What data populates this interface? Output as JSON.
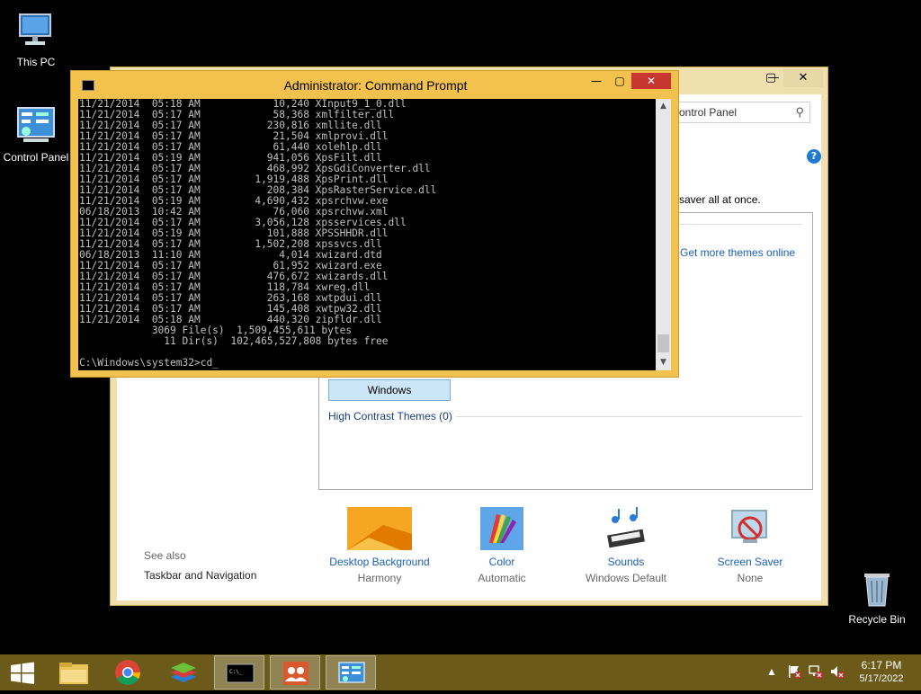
{
  "desktop": {
    "icons": [
      {
        "label": "This PC"
      },
      {
        "label": "Control Panel"
      },
      {
        "label": "Recycle Bin"
      }
    ]
  },
  "control_panel": {
    "search_text": "ontrol Panel",
    "description": "saver all at once.",
    "get_more_themes": "Get more themes online",
    "theme_selected": "Windows",
    "high_contrast": "High Contrast Themes (0)",
    "see_also": "See also",
    "taskbar_navigation": "Taskbar and Navigation",
    "bottom": [
      {
        "name": "Desktop Background",
        "value": "Harmony"
      },
      {
        "name": "Color",
        "value": "Automatic"
      },
      {
        "name": "Sounds",
        "value": "Windows Default"
      },
      {
        "name": "Screen Saver",
        "value": "None"
      }
    ]
  },
  "cmd": {
    "title": "Administrator: Command Prompt",
    "output": "11/21/2014  05:18 AM            10,240 XInput9_1_0.dll\n11/21/2014  05:17 AM            58,368 xmlfilter.dll\n11/21/2014  05:17 AM           230,816 xmllite.dll\n11/21/2014  05:17 AM            21,504 xmlprovi.dll\n11/21/2014  05:17 AM            61,440 xolehlp.dll\n11/21/2014  05:19 AM           941,056 XpsFilt.dll\n11/21/2014  05:17 AM           468,992 XpsGdiConverter.dll\n11/21/2014  05:17 AM         1,919,488 XpsPrint.dll\n11/21/2014  05:17 AM           208,384 XpsRasterService.dll\n11/21/2014  05:19 AM         4,690,432 xpsrchvw.exe\n06/18/2013  10:42 AM            76,060 xpsrchvw.xml\n11/21/2014  05:17 AM         3,056,128 xpsservices.dll\n11/21/2014  05:19 AM           101,888 XPSSHHDR.dll\n11/21/2014  05:17 AM         1,502,208 xpssvcs.dll\n06/18/2013  11:10 AM             4,014 xwizard.dtd\n11/21/2014  05:17 AM            61,952 xwizard.exe\n11/21/2014  05:17 AM           476,672 xwizards.dll\n11/21/2014  05:17 AM           118,784 xwreg.dll\n11/21/2014  05:17 AM           263,168 xwtpdui.dll\n11/21/2014  05:17 AM           145,408 xwtpw32.dll\n11/21/2014  05:18 AM           440,320 zipfldr.dll\n            3069 File(s)  1,509,455,611 bytes\n              11 Dir(s)  102,465,527,808 bytes free\n\nC:\\Windows\\system32>cd_"
  },
  "taskbar": {
    "time": "6:17 PM",
    "date": "5/17/2022"
  },
  "colors": {
    "taskbar": "#6b5a1a",
    "cmd_frame": "#f2c14e",
    "close_button": "#c7372f",
    "link": "#1a5fb4"
  }
}
